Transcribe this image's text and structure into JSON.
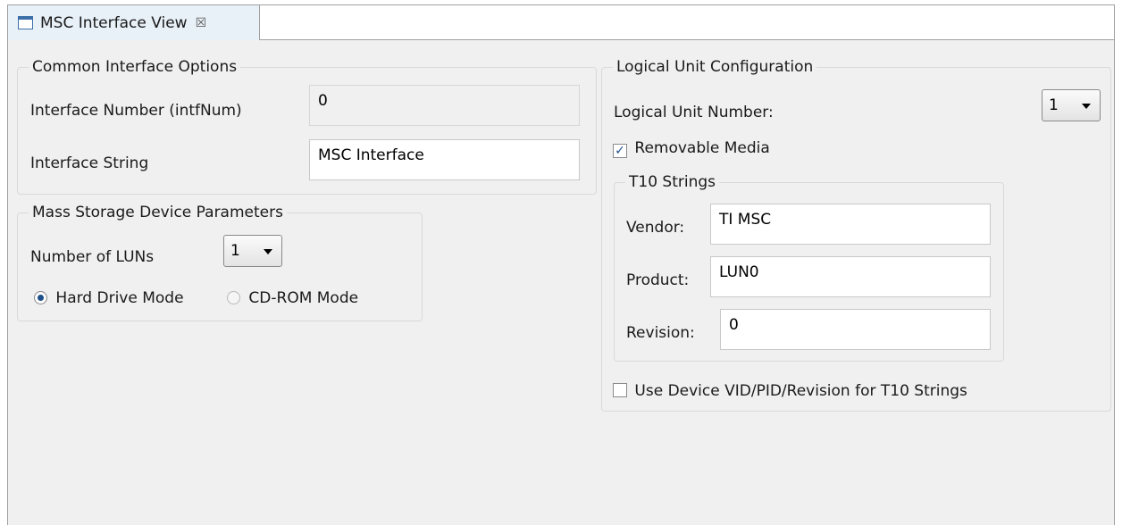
{
  "tab": {
    "title": "MSC Interface View",
    "close_glyph": "☒",
    "icon": "view-window-icon"
  },
  "common": {
    "legend": "Common Interface Options",
    "intf_num_label": "Interface Number (intfNum)",
    "intf_num_value": "0",
    "intf_string_label": "Interface String",
    "intf_string_value": "MSC Interface"
  },
  "mass": {
    "legend": "Mass Storage Device Parameters",
    "num_luns_label": "Number of LUNs",
    "num_luns_value": "1",
    "hard_drive_label": "Hard Drive Mode",
    "cdrom_label": "CD-ROM Mode",
    "mode_selected": "Hard Drive Mode"
  },
  "lu": {
    "legend": "Logical Unit Configuration",
    "lun_label": "Logical Unit Number:",
    "lun_value": "1",
    "removable_label": "Removable Media",
    "removable_checked": true,
    "removable_mark": "✓",
    "t10": {
      "legend": "T10 Strings",
      "vendor_label": "Vendor:",
      "vendor_value": "TI MSC",
      "product_label": "Product:",
      "product_value": "LUN0",
      "revision_label": "Revision:",
      "revision_value": "0"
    },
    "use_device_label": "Use Device VID/PID/Revision for T10 Strings",
    "use_device_checked": false
  },
  "colors": {
    "accent": "#1e4f8a",
    "panel_bg": "#f0f0f0",
    "tab_bg": "#e8f0f8"
  }
}
